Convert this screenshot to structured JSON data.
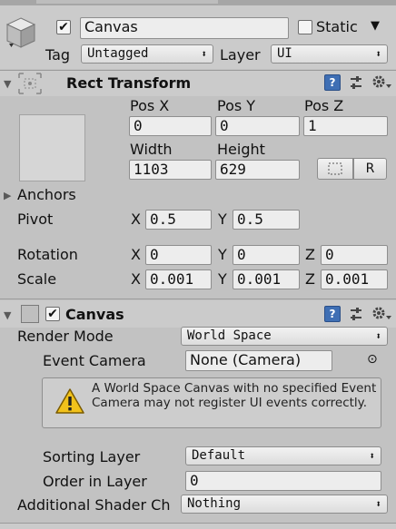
{
  "gameobject": {
    "name": "Canvas",
    "active": true,
    "static_label": "Static",
    "tag_label": "Tag",
    "tag_value": "Untagged",
    "layer_label": "Layer",
    "layer_value": "UI"
  },
  "rect_transform": {
    "title": "Rect Transform",
    "pos_x_label": "Pos X",
    "pos_y_label": "Pos Y",
    "pos_z_label": "Pos Z",
    "pos_x": "0",
    "pos_y": "0",
    "pos_z": "1",
    "width_label": "Width",
    "height_label": "Height",
    "width": "1103",
    "height": "629",
    "r_button": "R",
    "anchors_label": "Anchors",
    "pivot_label": "Pivot",
    "pivot_x": "0.5",
    "pivot_y": "0.5",
    "rotation_label": "Rotation",
    "rot_x": "0",
    "rot_y": "0",
    "rot_z": "0",
    "scale_label": "Scale",
    "scale_x": "0.001",
    "scale_y": "0.001",
    "scale_z": "0.001",
    "axis_x": "X",
    "axis_y": "Y",
    "axis_z": "Z"
  },
  "canvas": {
    "title": "Canvas",
    "enabled": true,
    "render_mode_label": "Render Mode",
    "render_mode_value": "World Space",
    "event_camera_label": "Event Camera",
    "event_camera_value": "None (Camera)",
    "warning": "A World Space Canvas with no specified Event Camera may not register UI events correctly.",
    "sorting_layer_label": "Sorting Layer",
    "sorting_layer_value": "Default",
    "order_label": "Order in Layer",
    "order_value": "0",
    "shader_label": "Additional Shader Ch",
    "shader_value": "Nothing"
  },
  "icons": {
    "help": "help-icon",
    "presets": "presets-icon",
    "gear": "gear-icon",
    "dropdown_arrow": "⬍",
    "object_picker": "⊙",
    "checkmark": "✔",
    "fold_down": "▼",
    "fold_right": "▶"
  }
}
